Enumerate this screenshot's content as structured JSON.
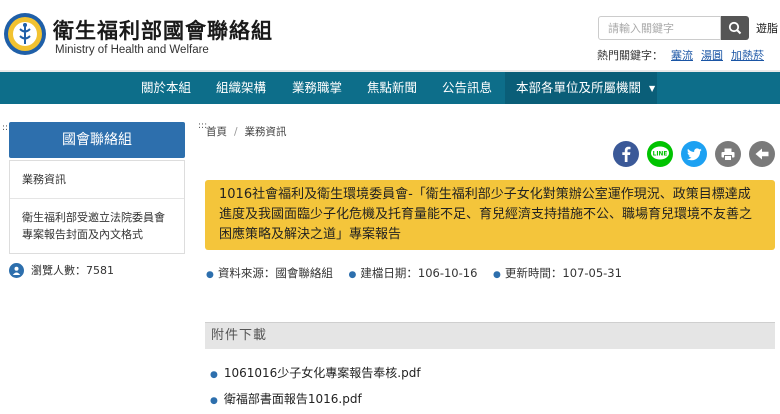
{
  "header": {
    "title_zh": "衛生福利部國會聯絡組",
    "title_en": "Ministry of Health and Welfare",
    "search_placeholder": "請輸入關鍵字",
    "top_link": "遊脂",
    "hot_keywords_label": "熱門關鍵字：",
    "hot_keywords": [
      "塞流",
      "湯圓",
      "加熱菸"
    ]
  },
  "nav": {
    "items": [
      "關於本組",
      "組織架構",
      "業務職掌",
      "焦點新聞",
      "公告訊息"
    ],
    "active": "本部各單位及所屬機關"
  },
  "sidebar": {
    "heading": "國會聯絡組",
    "items": [
      "業務資訊",
      "衛生福利部受邀立法院委員會專案報告封面及內文格式"
    ],
    "views": "瀏覽人數：7581"
  },
  "breadcrumb": [
    "首頁",
    "業務資訊"
  ],
  "share_icons": [
    "facebook-icon",
    "line-icon",
    "twitter-icon",
    "print-icon",
    "back-icon"
  ],
  "colors": {
    "nav": "#0d6e8a",
    "sidebar_head": "#2d6fad",
    "title_box": "#f4c53b",
    "facebook": "#3b5998",
    "line": "#00c300",
    "twitter": "#1da1f2",
    "grey_icon": "#7a7a7a"
  },
  "article": {
    "title": "1016社會福利及衛生環境委員會-「衛生福利部少子女化對策辦公室運作現況、政策目標達成進度及我國面臨少子化危機及托育量能不足、育兒經濟支持措施不公、職場育兒環境不友善之困應策略及解決之道」專案報告",
    "source": "資料來源：國會聯絡組",
    "created": "建檔日期：106-10-16",
    "updated": "更新時間：107-05-31"
  },
  "attachments": {
    "heading": "附件下載",
    "files": [
      "1061016少子女化專案報告奉核.pdf",
      "衛福部書面報告1016.pdf"
    ]
  }
}
